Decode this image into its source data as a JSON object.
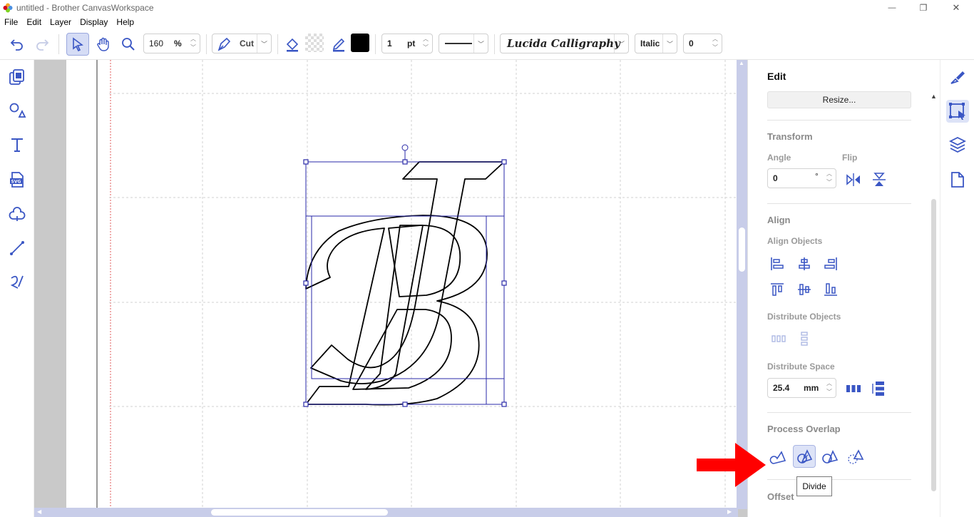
{
  "window": {
    "title": "untitled - Brother CanvasWorkspace",
    "minimize_glyph": "—",
    "restore_glyph": "❐",
    "close_glyph": "✕"
  },
  "menu": [
    "File",
    "Edit",
    "Layer",
    "Display",
    "Help"
  ],
  "toolbar": {
    "zoom_value": "160",
    "zoom_unit": "%",
    "mode_label": "Cut",
    "line_width_value": "1",
    "line_width_unit": "pt",
    "font_name": "Lucida Calligraphy",
    "font_style": "Italic",
    "char_spacing_value": "0",
    "accent_color": "#3a56c4",
    "fill_color": "#000000"
  },
  "left_tools": [
    {
      "icon": "pattern-library-icon"
    },
    {
      "icon": "shapes-icon"
    },
    {
      "icon": "text-icon"
    },
    {
      "icon": "svg-import-icon"
    },
    {
      "icon": "trace-icon"
    },
    {
      "icon": "line-tool-icon"
    },
    {
      "icon": "freehand-icon"
    }
  ],
  "right_panel": {
    "title": "Edit",
    "resize_button": "Resize...",
    "transform": {
      "title": "Transform",
      "angle_label": "Angle",
      "angle_value": "0",
      "angle_unit": "°",
      "flip_label": "Flip"
    },
    "align": {
      "title": "Align",
      "align_objects_label": "Align Objects",
      "distribute_objects_label": "Distribute Objects",
      "distribute_space_label": "Distribute Space",
      "distribute_space_value": "25.4",
      "distribute_space_unit": "mm"
    },
    "process_overlap": {
      "title": "Process Overlap"
    },
    "offset_title": "Offset"
  },
  "tooltip": "Divide",
  "arrow_color": "#ff0000"
}
